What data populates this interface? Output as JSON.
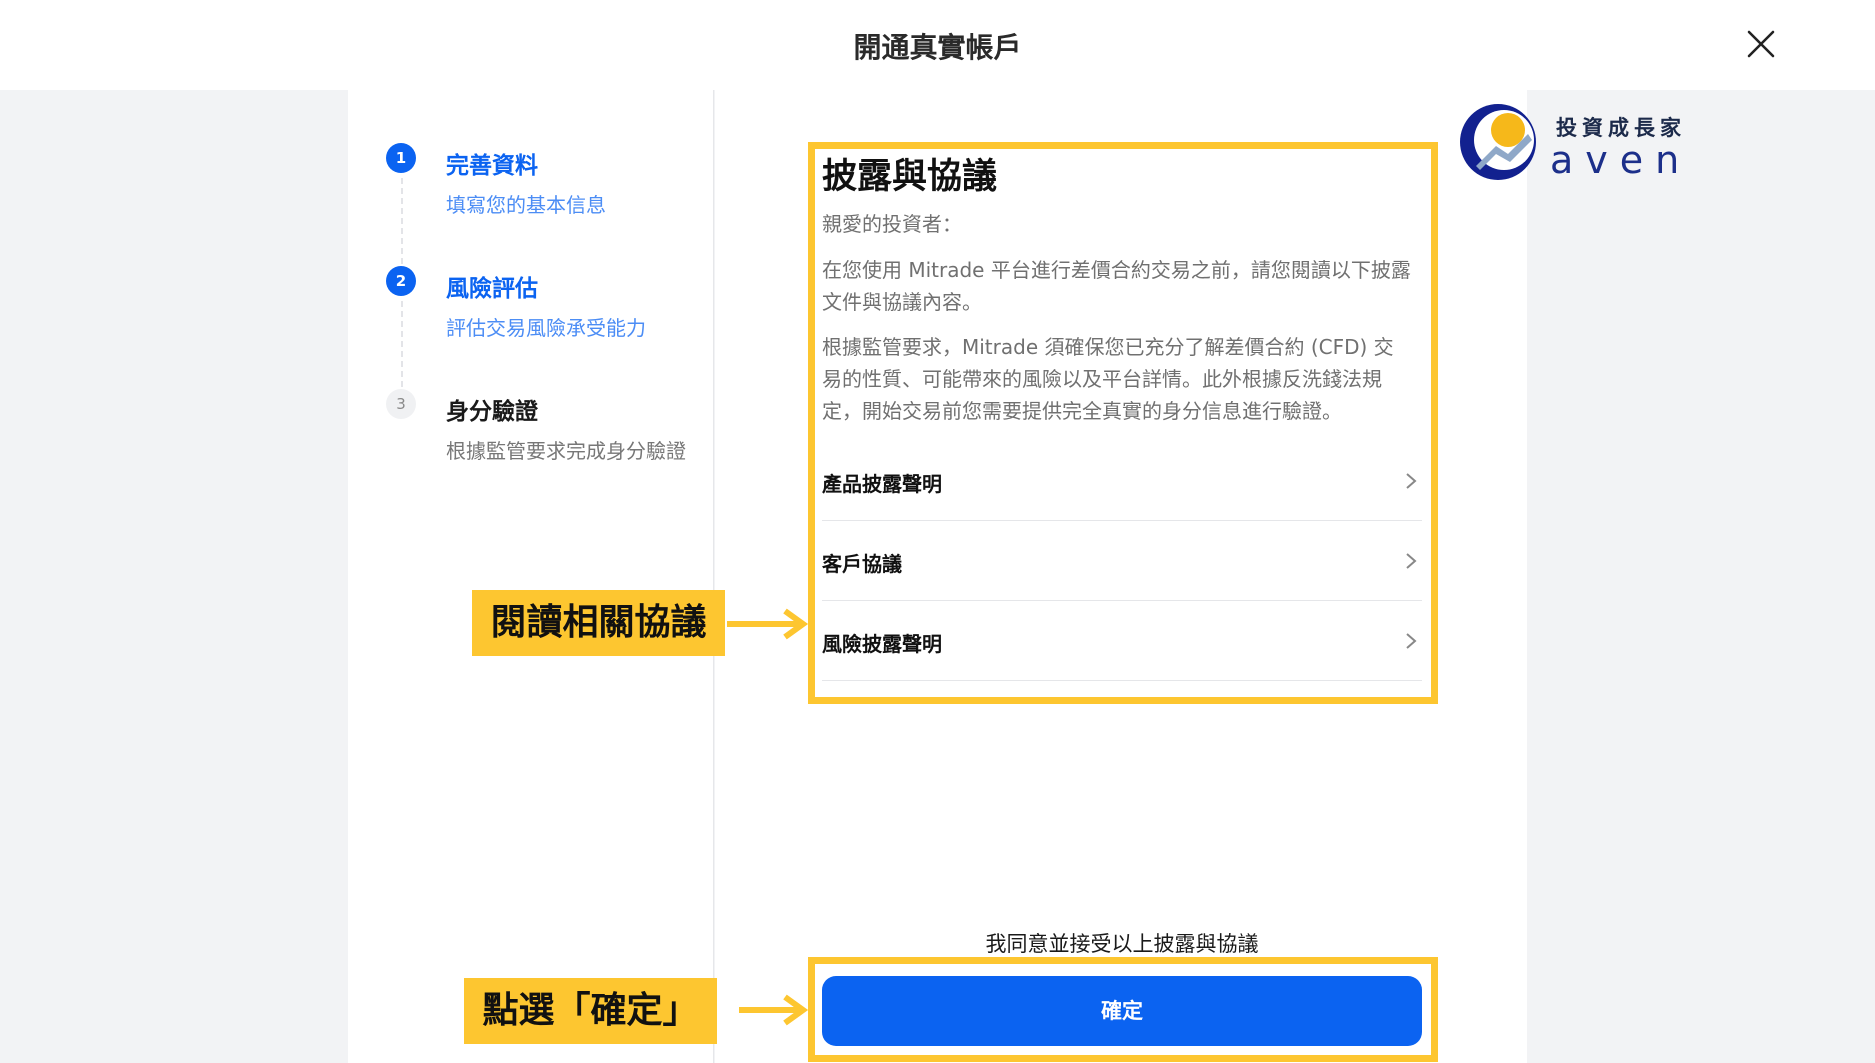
{
  "header": {
    "title": "開通真實帳戶"
  },
  "steps": [
    {
      "number": "1",
      "title": "完善資料",
      "desc": "填寫您的基本信息"
    },
    {
      "number": "2",
      "title": "風險評估",
      "desc": "評估交易風險承受能力"
    },
    {
      "number": "3",
      "title": "身分驗證",
      "desc": "根據監管要求完成身分驗證"
    }
  ],
  "content": {
    "title": "披露與協議",
    "greeting": "親愛的投資者：",
    "para1": "在您使用 Mitrade 平台進行差價合約交易之前，請您閱讀以下披露文件與協議內容。",
    "para2": "根據監管要求，Mitrade 須確保您已充分了解差價合約 (CFD) 交易的性質、可能帶來的風險以及平台詳情。此外根據反洗錢法規定，開始交易前您需要提供完全真實的身分信息進行驗證。",
    "agreements": [
      "產品披露聲明",
      "客戶協議",
      "風險披露聲明"
    ],
    "consent": "我同意並接受以上披露與協議",
    "confirm_label": "確定"
  },
  "annotations": {
    "read_callout": "閱讀相關協議",
    "click_callout": "點選「確定」",
    "highlight_color": "#fdc630"
  },
  "logo": {
    "top_text": "投資成長家",
    "bottom_text": "aven"
  },
  "colors": {
    "accent": "#0b63f1",
    "background": "#f2f3f5"
  }
}
